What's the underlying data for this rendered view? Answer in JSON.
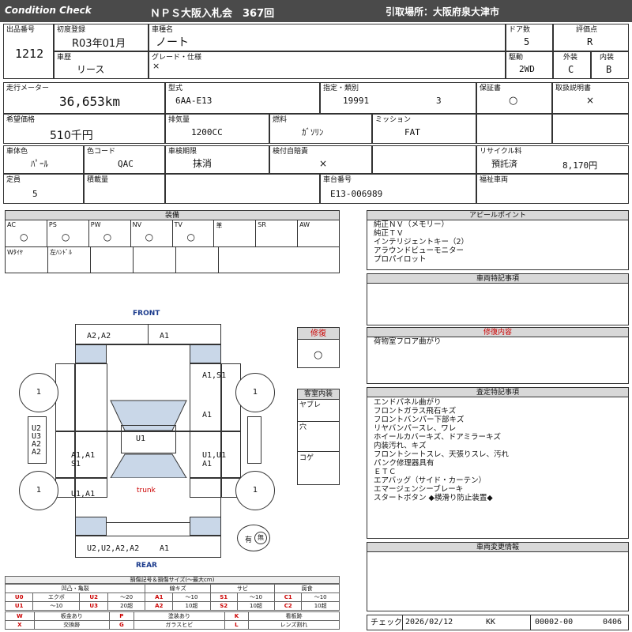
{
  "header": {
    "condition_check": "Condition Check",
    "auction": "ＮＰＳ大阪入札会　367回",
    "pickup": "引取場所：大阪府泉大津市"
  },
  "row1": {
    "lot_label": "出品番号",
    "lot": "1212",
    "first_reg_label": "初度登録",
    "first_reg": "R03年01月",
    "model_label": "車種名",
    "model": "ノート",
    "doors_label": "ドア数",
    "doors": "5",
    "grade_score_label": "評価点",
    "grade_score": "R",
    "history_label": "車歴",
    "history": "リース",
    "grade_label": "グレード・仕様",
    "grade": "×",
    "drive_label": "駆動",
    "drive": "2WD",
    "exterior_label": "外装",
    "exterior": "C",
    "interior_label": "内装",
    "interior": "B"
  },
  "row2": {
    "odometer_label": "走行メーター",
    "odometer": "36,653km",
    "type_label": "型式",
    "type": "6AA-E13",
    "designation_label": "指定・類別",
    "designation": "19991",
    "category": "3",
    "warranty_label": "保証書",
    "warranty": "○",
    "manual_label": "取扱説明書",
    "manual": "×",
    "price_label": "希望価格",
    "price": "510千円",
    "displacement_label": "排気量",
    "displacement": "1200CC",
    "fuel_label": "燃料",
    "fuel": "ｶﾞｿﾘﾝ",
    "transmission_label": "ミッション",
    "transmission": "FAT"
  },
  "row3": {
    "color_label": "車体色",
    "color": "ﾊﾟｰﾙ",
    "color_code_label": "色コード",
    "color_code": "QAC",
    "inspection_label": "車検期限",
    "inspection": "抹消",
    "insurance_label": "検付自賠責",
    "insurance": "×",
    "recycle_label": "リサイクル料",
    "recycle_status": "預託済",
    "recycle_amount": "8,170円",
    "capacity_label": "定員",
    "capacity": "5",
    "load_label": "積載量",
    "load": "",
    "chassis_label": "車台番号",
    "chassis": "E13-006989",
    "welfare_label": "福祉車両",
    "welfare": ""
  },
  "equipment": {
    "title": "装備",
    "top": [
      {
        "name": "AC",
        "mark": "○"
      },
      {
        "name": "PS",
        "mark": "○"
      },
      {
        "name": "PW",
        "mark": "○"
      },
      {
        "name": "NV",
        "mark": "○"
      },
      {
        "name": "TV",
        "mark": "○"
      },
      {
        "name": "革",
        "mark": ""
      },
      {
        "name": "SR",
        "mark": ""
      },
      {
        "name": "AW",
        "mark": ""
      }
    ],
    "bottom": [
      {
        "name": "Wﾀｲﾔ"
      },
      {
        "name": "左ﾊﾝﾄﾞﾙ"
      },
      {
        "name": ""
      },
      {
        "name": ""
      },
      {
        "name": ""
      }
    ]
  },
  "appeal": {
    "title": "アピールポイント",
    "lines": [
      "純正ＮＶ（メモリー）",
      "純正ＴＶ",
      "インテリジェントキー（2）",
      "アラウンドビューモニター",
      "プロパイロット"
    ]
  },
  "special_notes": {
    "title": "車両特記事項"
  },
  "repair": {
    "title": "修復",
    "mark": "○"
  },
  "repair_details": {
    "title": "修復内容",
    "lines": [
      "荷物室フロア曲がり"
    ]
  },
  "cabin": {
    "title": "客室内装",
    "items": [
      "ヤブレ",
      "穴",
      "コゲ"
    ]
  },
  "inspection_notes": {
    "title": "査定特記事項",
    "lines": [
      "エンドパネル曲がり",
      "フロントガラス飛石キズ",
      "フロントバンパー下部キズ",
      "リヤバンパースレ、ワレ",
      "ホイールカバーキズ、ドアミラーキズ",
      "内装汚れ、キズ",
      "フロントシートスレ、天張りスレ、汚れ",
      "パンク修理器具有",
      "ＥＴＣ",
      "エアバッグ（サイド・カーテン）",
      "エマージェンシーブレーキ",
      "スタートボタン ◆横滑り防止装置◆"
    ]
  },
  "changes": {
    "title": "車両変更情報"
  },
  "diagram": {
    "front": "FRONT",
    "rear": "REAR",
    "trunk": "trunk",
    "tire_fl": "1",
    "tire_fr": "1",
    "tire_rl": "1",
    "tire_rr": "1",
    "front_bumper_left": "A2,A2",
    "front_bumper_right": "A1",
    "right_front_fender": "A1,S1",
    "right_front_door": "A1",
    "right_rear_door": "U1,U1\nA1",
    "left_rear_door": "A1,A1\nS1",
    "left_rear_quarter": "U1,A1",
    "roof": "U1",
    "rear_bumper": "U2,U2,A2,A2",
    "rear_bumper_right": "A1",
    "windshield_label": "U2\nU3\nA2\nA2",
    "spare_tire": "有",
    "spare_mark": "無"
  },
  "legend": {
    "title": "損傷記号＆損傷サイズ(〜最大cm)",
    "headers": [
      "凹凸・亀裂",
      "",
      "線キズ",
      "サビ",
      "腐食"
    ],
    "rows": [
      [
        "U0",
        "エクボ",
        "U2",
        "〜20",
        "A1",
        "〜10",
        "S1",
        "〜10",
        "C1",
        "〜10"
      ],
      [
        "U1",
        "〜10",
        "U3",
        "20超",
        "A2",
        "10超",
        "S2",
        "10超",
        "C2",
        "10超"
      ]
    ],
    "marks": [
      [
        "W",
        "板金あり",
        "P",
        "塗装あり",
        "K",
        "看板跡"
      ],
      [
        "X",
        "交換跡",
        "G",
        "ガラスヒビ",
        "L",
        "レンズ割れ"
      ]
    ]
  },
  "footer": {
    "check_label": "チェック",
    "check_date": "2026/02/12",
    "checker": "KK",
    "code": "00002-00",
    "code2": "0406"
  }
}
